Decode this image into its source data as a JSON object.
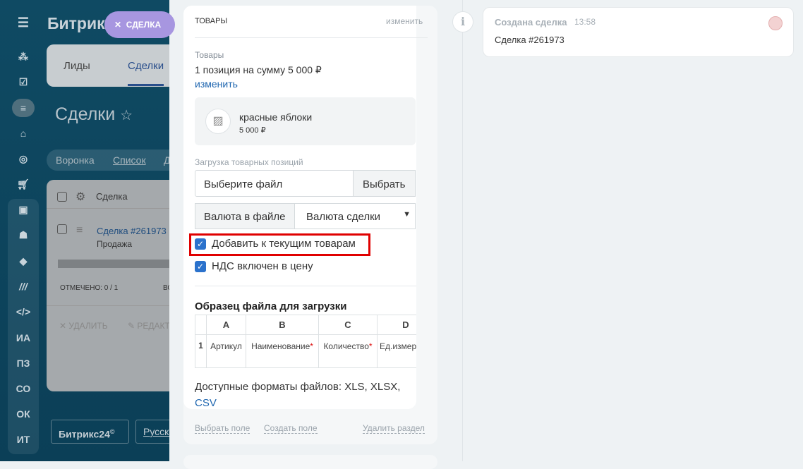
{
  "background": {
    "brand": "Битрикс",
    "close_pill": "СДЕЛКА",
    "tabs": [
      "Лиды",
      "Сделки"
    ],
    "page_title": "Сделки",
    "views": [
      "Воронка",
      "Список",
      "Д"
    ],
    "grid": {
      "header": "Сделка",
      "row_title": "Сделка #261973",
      "row_sub": "Продажа",
      "selected": "ОТМЕЧЕНО: 0 / 1",
      "total": "ВС",
      "delete": "УДАЛИТЬ",
      "edit": "РЕДАКТ"
    },
    "footer": {
      "brand_button": "Битрикс24",
      "language": "Русски"
    },
    "sidebar_text_items": [
      "ИА",
      "ПЗ",
      "СО",
      "ОК",
      "ИТ"
    ]
  },
  "products": {
    "section_title": "ТОВАРЫ",
    "change_section": "изменить",
    "label": "Товары",
    "summary": "1 позиция на сумму 5 000 ₽",
    "change_link": "изменить",
    "item": {
      "name": "красные яблоки",
      "price": "5 000 ₽"
    },
    "upload_label": "Загрузка товарных позиций",
    "file_placeholder": "Выберите файл",
    "choose_button": "Выбрать",
    "currency_label": "Валюта в файле",
    "currency_value": "Валюта сделки",
    "checkbox_add": "Добавить к текущим товарам",
    "checkbox_vat": "НДС включен в цену",
    "sample_title": "Образец файла для загрузки",
    "sample_table": {
      "columns": [
        "A",
        "B",
        "C",
        "D"
      ],
      "row_num": "1",
      "cells": [
        "Артикул",
        "Наименование",
        "Количество",
        "Ед.измер"
      ],
      "required": [
        false,
        true,
        true,
        false
      ]
    },
    "formats_text": "Доступные форматы файлов: XLS, XLSX,",
    "formats_link": "CSV",
    "footer_links": {
      "select_field": "Выбрать поле",
      "create_field": "Создать поле",
      "delete_section": "Удалить раздел"
    }
  },
  "timeline": {
    "event_title": "Создана сделка",
    "time": "13:58",
    "body": "Сделка #261973"
  },
  "colors": {
    "accent": "#2067b0",
    "highlight": "#e00000",
    "checkbox": "#2b72cc"
  }
}
